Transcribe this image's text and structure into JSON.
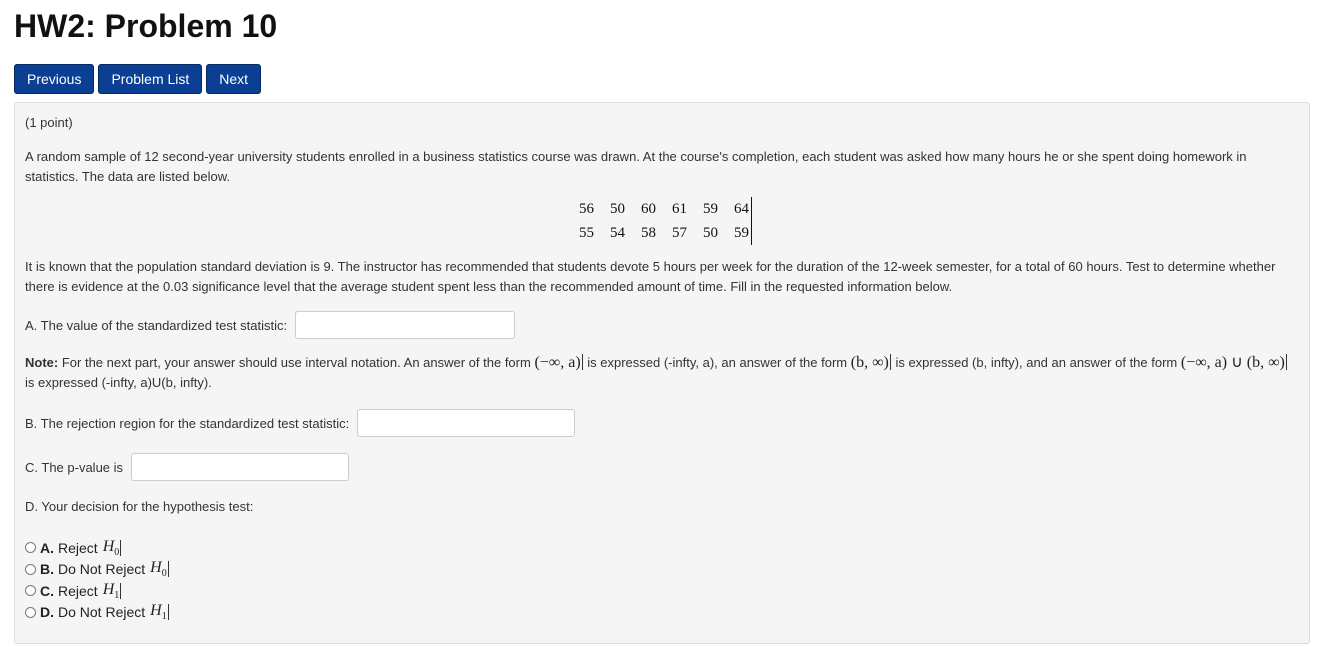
{
  "page": {
    "title": "HW2: Problem 10"
  },
  "nav": {
    "previous": "Previous",
    "problem_list": "Problem List",
    "next": "Next"
  },
  "problem": {
    "points": "(1 point)",
    "intro": "A random sample of 12 second-year university students enrolled in a business statistics course was drawn. At the course's completion, each student was asked how many hours he or she spent doing homework in statistics. The data are listed below.",
    "data_rows": [
      [
        "56",
        "50",
        "60",
        "61",
        "59",
        "64"
      ],
      [
        "55",
        "54",
        "58",
        "57",
        "50",
        "59"
      ]
    ],
    "paragraph2": "It is known that the population standard deviation is 9. The instructor has recommended that students devote 5 hours per week for the duration of the 12-week semester, for a total of 60 hours. Test to determine whether there is evidence at the 0.03 significance level that the average student spent less than the recommended amount of time. Fill in the requested information below.",
    "part_a_label": "A. The value of the standardized test statistic:",
    "part_a_value": "",
    "note_label": "Note:",
    "note_text_1": "For the next part, your answer should use interval notation. An answer of the form",
    "note_math_1": "(−∞, a)",
    "note_text_2": "is expressed (-infty, a), an answer of the form",
    "note_math_2": "(b, ∞)",
    "note_text_3": "is expressed (b, infty), and an answer of the form",
    "note_math_3": "(−∞, a) ∪ (b, ∞)",
    "note_text_4": "is expressed (-infty, a)U(b, infty).",
    "part_b_label": "B. The rejection region for the standardized test statistic:",
    "part_b_value": "",
    "part_c_label": "C. The p-value is",
    "part_c_value": "",
    "part_d_label": "D. Your decision for the hypothesis test:",
    "options": [
      {
        "letter": "A.",
        "text": "Reject",
        "symbol": "H",
        "sub": "0"
      },
      {
        "letter": "B.",
        "text": "Do Not Reject",
        "symbol": "H",
        "sub": "0"
      },
      {
        "letter": "C.",
        "text": "Reject",
        "symbol": "H",
        "sub": "1"
      },
      {
        "letter": "D.",
        "text": "Do Not Reject",
        "symbol": "H",
        "sub": "1"
      }
    ]
  }
}
